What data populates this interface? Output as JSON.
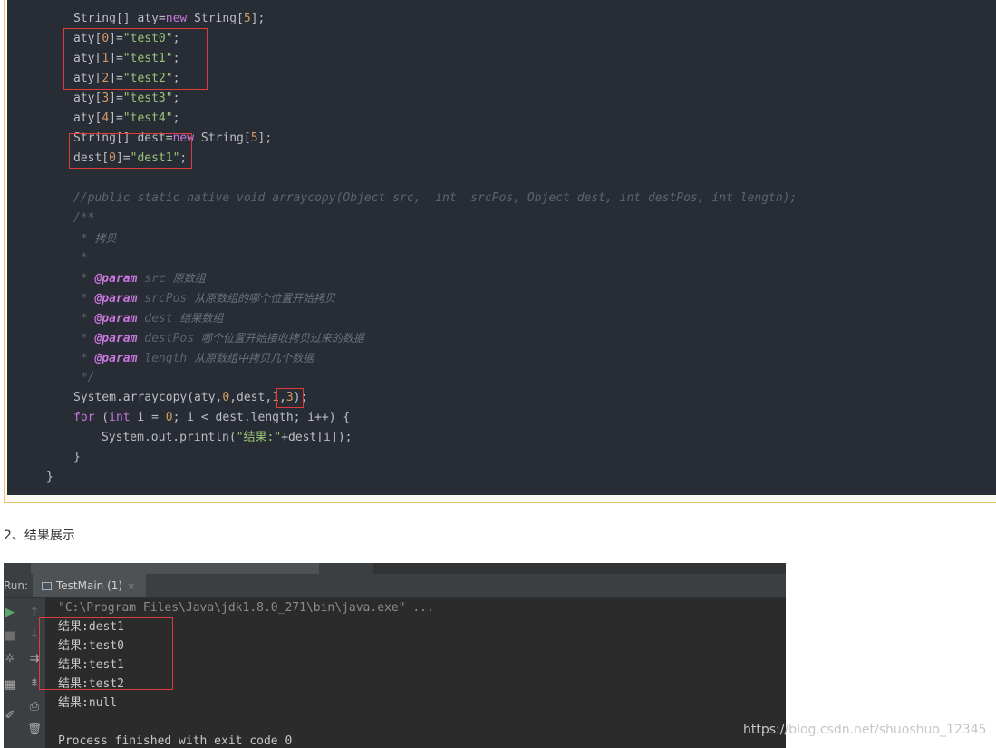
{
  "code": {
    "line1": {
      "type": "String[] aty=",
      "kw": "new",
      "type2": " String[",
      "num": "5",
      "end": "];"
    },
    "line2": {
      "a": "aty[",
      "n": "0",
      "b": "]=",
      "s": "\"test0\"",
      "e": ";"
    },
    "line3": {
      "a": "aty[",
      "n": "1",
      "b": "]=",
      "s": "\"test1\"",
      "e": ";"
    },
    "line4": {
      "a": "aty[",
      "n": "2",
      "b": "]=",
      "s": "\"test2\"",
      "e": ";"
    },
    "line5": {
      "a": "aty[",
      "n": "3",
      "b": "]=",
      "s": "\"test3\"",
      "e": ";"
    },
    "line6": {
      "a": "aty[",
      "n": "4",
      "b": "]=",
      "s": "\"test4\"",
      "e": ";"
    },
    "line7": {
      "type": "String[] dest=",
      "kw": "new",
      "type2": " String[",
      "num": "5",
      "end": "];"
    },
    "line8": {
      "a": "dest[",
      "n": "0",
      "b": "]=",
      "s": "\"dest1\"",
      "e": ";"
    },
    "comment": "//public static native void arraycopy(Object src,  int  srcPos, Object dest, int destPos, int length);",
    "doc_open": "/**",
    "doc_title_star": " * ",
    "doc_title": "拷贝",
    "doc_blank": " *",
    "doc_star": " * ",
    "param_tag": "@param",
    "params": [
      {
        "name": " src ",
        "desc": "原数组"
      },
      {
        "name": " srcPos ",
        "desc": "从原数组的哪个位置开始拷贝"
      },
      {
        "name": " dest ",
        "desc": "结果数组"
      },
      {
        "name": " destPos ",
        "desc": "哪个位置开始接收拷贝过来的数据"
      },
      {
        "name": " length ",
        "desc": "从原数组中拷贝几个数据"
      }
    ],
    "doc_close": " */",
    "call": {
      "a": "System.arraycopy(aty,",
      "n1": "0",
      "b": ",dest,",
      "n2": "1",
      "c": ",",
      "n3": "3",
      "d": ");"
    },
    "for": {
      "kw": "for",
      "a": " (",
      "kw2": "int",
      "b": " i = ",
      "n": "0",
      "c": "; i < dest.length; i++) {"
    },
    "print": {
      "a": "System.out.println(",
      "s": "\"结果:\"",
      "b": "+dest[i]);"
    },
    "close_inner": "}",
    "close_outer": "}"
  },
  "heading": "2、结果展示",
  "run_panel": {
    "label": "Run:",
    "tab": "TestMain (1)",
    "tab_close": "×",
    "output": [
      "\"C:\\Program Files\\Java\\jdk1.8.0_271\\bin\\java.exe\" ...",
      "结果:dest1",
      "结果:test0",
      "结果:test1",
      "结果:test2",
      "结果:null",
      "",
      "Process finished with exit code 0"
    ]
  },
  "watermark": "https://blog.csdn.net/shuoshuo_12345",
  "colors": {
    "editor_bg": "#282c34",
    "highlight": "#e03b3b",
    "keyword": "#c678dd",
    "string": "#98c379",
    "number": "#d19a66"
  }
}
